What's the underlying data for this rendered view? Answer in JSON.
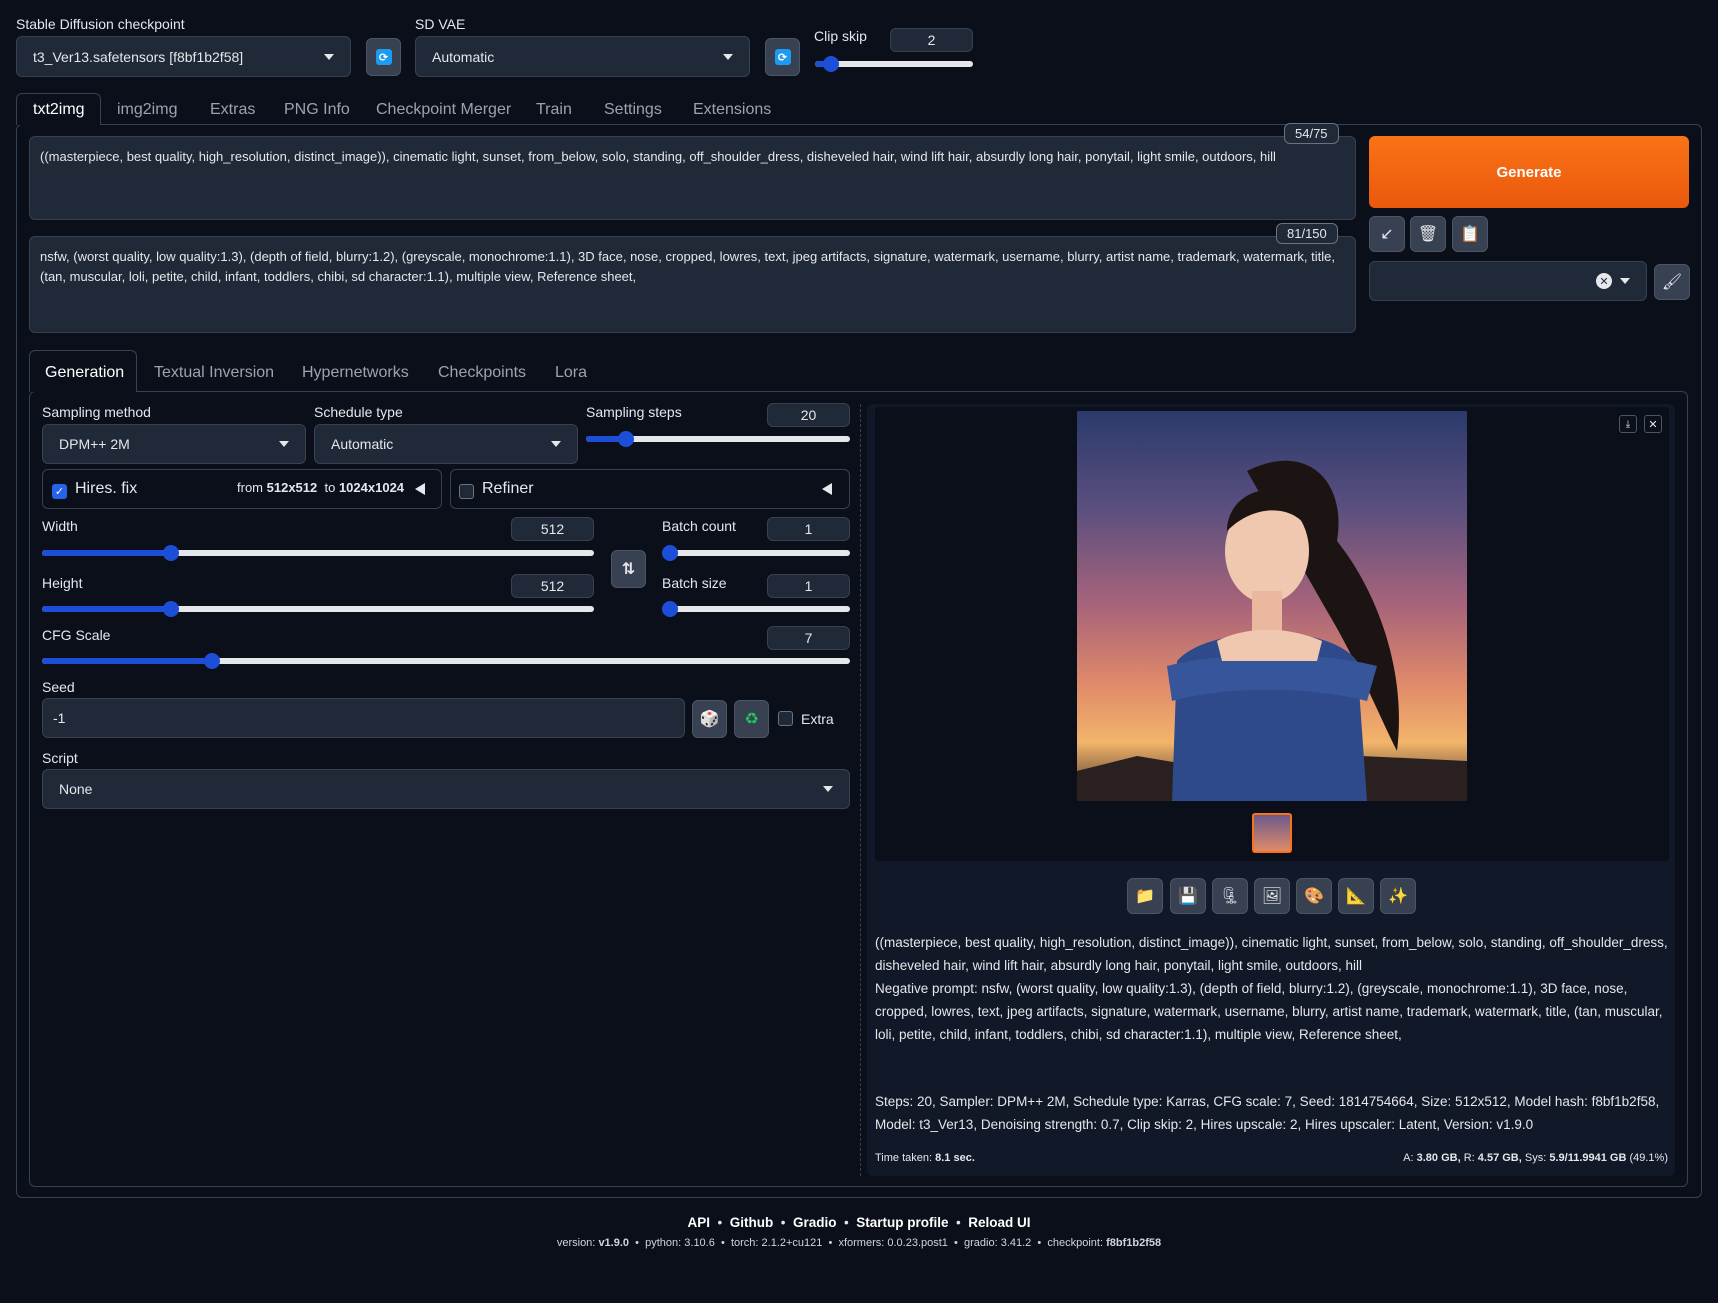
{
  "header": {
    "checkpoint_label": "Stable Diffusion checkpoint",
    "checkpoint_value": "t3_Ver13.safetensors [f8bf1b2f58]",
    "vae_label": "SD VAE",
    "vae_value": "Automatic",
    "clip_skip_label": "Clip skip",
    "clip_skip_value": "2",
    "clip_skip_fraction": 0.1
  },
  "main_tabs": [
    "txt2img",
    "img2img",
    "Extras",
    "PNG Info",
    "Checkpoint Merger",
    "Train",
    "Settings",
    "Extensions"
  ],
  "prompt": {
    "text": "((masterpiece, best quality, high_resolution, distinct_image)), cinematic light, sunset, from_below, solo, standing, off_shoulder_dress, disheveled hair, wind lift hair, absurdly long hair, ponytail, light smile, outdoors, hill",
    "token_count": "54/75"
  },
  "negative_prompt": {
    "text": "nsfw, (worst quality, low quality:1.3), (depth of field, blurry:1.2), (greyscale, monochrome:1.1), 3D face, nose, cropped, lowres, text, jpeg artifacts, signature, watermark, username, blurry, artist name, trademark, watermark, title, (tan, muscular, loli, petite, child, infant, toddlers, chibi, sd character:1.1), multiple view, Reference sheet,",
    "token_count": "81/150"
  },
  "generate_label": "Generate",
  "sub_tabs": [
    "Generation",
    "Textual Inversion",
    "Hypernetworks",
    "Checkpoints",
    "Lora"
  ],
  "generation": {
    "sampling_method_label": "Sampling method",
    "sampling_method_value": "DPM++ 2M",
    "schedule_type_label": "Schedule type",
    "schedule_type_value": "Automatic",
    "sampling_steps_label": "Sampling steps",
    "sampling_steps_value": "20",
    "sampling_steps_fraction": 0.15,
    "hires_label": "Hires. fix",
    "hires_from_prefix": "from",
    "hires_from": "512x512",
    "hires_to_prefix": "to",
    "hires_to": "1024x1024",
    "refiner_label": "Refiner",
    "width_label": "Width",
    "width_value": "512",
    "width_fraction": 0.234,
    "height_label": "Height",
    "height_value": "512",
    "height_fraction": 0.234,
    "batch_count_label": "Batch count",
    "batch_count_value": "1",
    "batch_size_label": "Batch size",
    "batch_size_value": "1",
    "cfg_label": "CFG Scale",
    "cfg_value": "7",
    "cfg_fraction": 0.21,
    "seed_label": "Seed",
    "seed_value": "-1",
    "extra_label": "Extra",
    "script_label": "Script",
    "script_value": "None"
  },
  "output": {
    "info_prompt": "((masterpiece, best quality, high_resolution, distinct_image)), cinematic light, sunset, from_below, solo, standing, off_shoulder_dress, disheveled hair, wind lift hair, absurdly long hair, ponytail, light smile, outdoors, hill",
    "info_negative": "Negative prompt: nsfw, (worst quality, low quality:1.3), (depth of field, blurry:1.2), (greyscale, monochrome:1.1), 3D face, nose, cropped, lowres, text, jpeg artifacts, signature, watermark, username, blurry, artist name, trademark, watermark, title, (tan, muscular, loli, petite, child, infant, toddlers, chibi, sd character:1.1), multiple view, Reference sheet,",
    "info_params": "Steps: 20, Sampler: DPM++ 2M, Schedule type: Karras, CFG scale: 7, Seed: 1814754664, Size: 512x512, Model hash: f8bf1b2f58, Model: t3_Ver13, Denoising strength: 0.7, Clip skip: 2, Hires upscale: 2, Hires upscaler: Latent, Version: v1.9.0",
    "time_label": "Time taken:",
    "time_value": "8.1 sec.",
    "mem_a_label": "A:",
    "mem_a": "3.80 GB,",
    "mem_r_label": "R:",
    "mem_r": "4.57 GB,",
    "mem_sys_label": "Sys:",
    "mem_sys": "5.9/11.9941 GB",
    "mem_pct": "(49.1%)"
  },
  "footer": {
    "links": [
      "API",
      "Github",
      "Gradio",
      "Startup profile",
      "Reload UI"
    ],
    "version_label": "version:",
    "version": "v1.9.0",
    "python_label": "python:",
    "python": "3.10.6",
    "torch_label": "torch:",
    "torch": "2.1.2+cu121",
    "xformers_label": "xformers:",
    "xformers": "0.0.23.post1",
    "gradio_label": "gradio:",
    "gradio": "3.41.2",
    "checkpoint_label": "checkpoint:",
    "checkpoint": "f8bf1b2f58"
  },
  "icons": {
    "refresh": "refresh-icon",
    "generate_tools": [
      "arrow-icon",
      "trash-icon",
      "clipboard-icon"
    ],
    "output_tools": [
      "folder-icon",
      "save-icon",
      "zip-icon",
      "image-icon",
      "palette-icon",
      "ruler-icon",
      "sparkle-icon"
    ]
  },
  "colors": {
    "accent": "#f97316",
    "slider": "#1d4ed8",
    "background": "#0b0f19"
  }
}
